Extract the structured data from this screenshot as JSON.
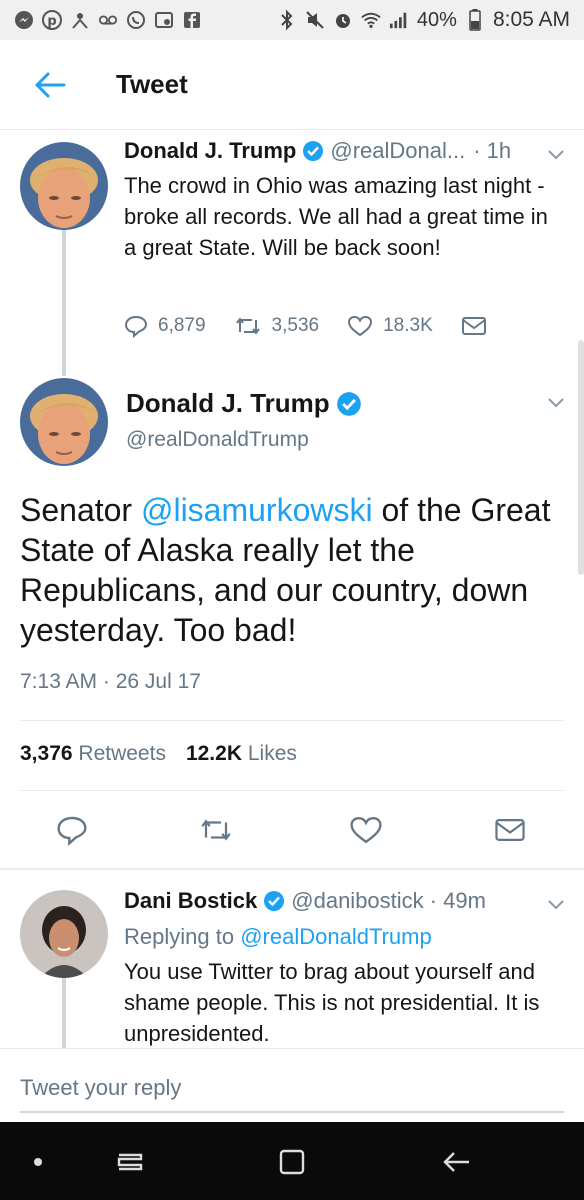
{
  "status_bar": {
    "battery": "40%",
    "time": "8:05 AM"
  },
  "header": {
    "title": "Tweet"
  },
  "parent_tweet": {
    "name": "Donald J. Trump",
    "handle": "@realDonal...",
    "time": "· 1h",
    "text": "The crowd in Ohio was amazing last night - broke all records. We all had a great time in a great State. Will be back soon!",
    "replies": "6,879",
    "retweets": "3,536",
    "likes": "18.3K"
  },
  "focus_tweet": {
    "name": "Donald J. Trump",
    "handle": "@realDonaldTrump",
    "text_before": "Senator ",
    "mention": "@lisamurkowski",
    "text_after": " of the Great State of Alaska really let the Republicans, and our country, down yesterday. Too bad!",
    "date": "7:13 AM · 26 Jul 17",
    "retweets_count": "3,376",
    "retweets_label": "Retweets",
    "likes_count": "12.2K",
    "likes_label": "Likes"
  },
  "reply_tweet": {
    "name": "Dani Bostick",
    "handle": "@danibostick",
    "time": "· 49m",
    "replying_prefix": "Replying to",
    "replying_handle": "@realDonaldTrump",
    "text": "You use Twitter to brag about yourself and shame people. This is not presidential. It is unpresidented."
  },
  "composer": {
    "placeholder": "Tweet your reply"
  },
  "colors": {
    "accent": "#1da1f2",
    "muted": "#657786"
  }
}
